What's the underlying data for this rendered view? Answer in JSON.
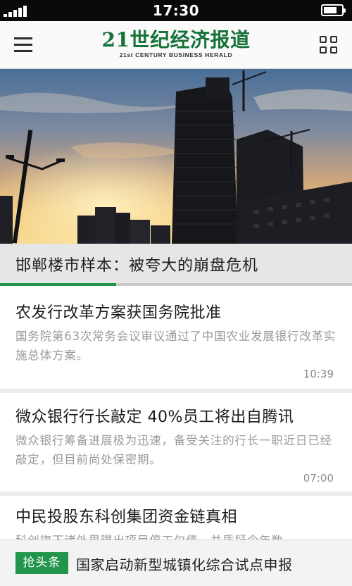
{
  "status_bar": {
    "time": "17:30",
    "signal_bars": 5,
    "battery_level": 0.75
  },
  "header": {
    "logo_text": "21世纪经济报道",
    "logo_subtitle": "21st CENTURY BUSINESS HERALD",
    "menu_icon": "hamburger-menu-icon",
    "apps_icon": "grid-apps-icon"
  },
  "hero": {
    "image_alt": "Construction site skyline at sunset",
    "caption": "邯郸楼市样本：被夸大的崩盘危机",
    "pages": 3,
    "active_page": 1
  },
  "news": [
    {
      "title": "农发行改革方案获国务院批准",
      "summary": "国务院第63次常务会议审议通过了中国农业发展银行改革实施总体方案。",
      "time": "10:39"
    },
    {
      "title": "微众银行行长敲定  40%员工将出自腾讯",
      "summary": "微众银行筹备进展极为迅速，备受关注的行长一职近日已经敲定，但目前尚处保密期。",
      "time": "07:00"
    },
    {
      "title": "中民投股东科创集团资金链真相",
      "summary": "科创旗下诸外界曝出项目停工欠债，并质疑今年数",
      "time": ""
    }
  ],
  "ticker": {
    "badge": "抢头条",
    "text": "国家启动新型城镇化综合试点申报"
  },
  "colors": {
    "brand_green": "#17723a",
    "accent_green": "#21954a"
  }
}
